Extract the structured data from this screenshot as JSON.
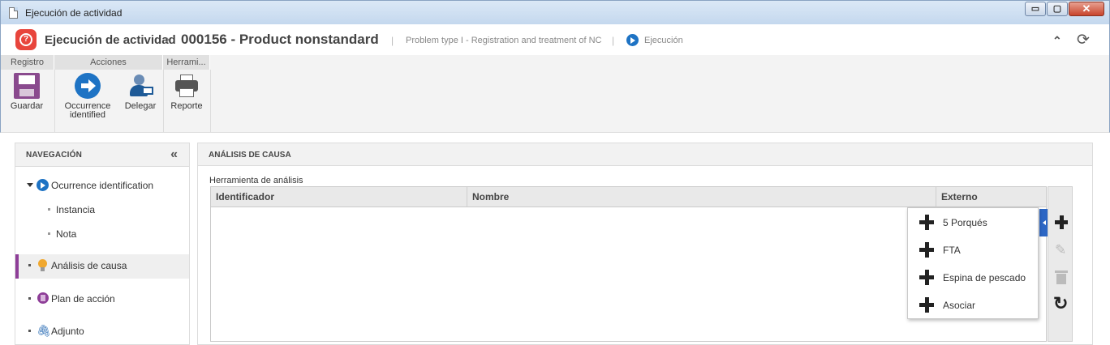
{
  "window": {
    "title": "Ejecución de actividad",
    "buttons": {
      "minimize": "▭",
      "maximize": "▢",
      "close": "✕"
    }
  },
  "header": {
    "logo_glyph": "?",
    "title": "Ejecución de actividad",
    "separator": "›",
    "record": "000156 - Product nonstandard",
    "divider": "|",
    "process": "Problem type I - Registration and treatment of NC",
    "status": "Ejecución",
    "collapse_glyph": "⌃",
    "refresh_glyph": "⟳"
  },
  "ribbon": {
    "groups": [
      {
        "label": "Registro"
      },
      {
        "label": "Acciones"
      },
      {
        "label": "Herrami..."
      }
    ],
    "buttons": {
      "save": "Guardar",
      "occurrence_line1": "Occurrence",
      "occurrence_line2": "identified",
      "delegate": "Delegar",
      "report": "Reporte"
    }
  },
  "navigation": {
    "title": "NAVEGACIÓN",
    "collapse_glyph": "«",
    "items": [
      {
        "label": "Ocurrence identification"
      },
      {
        "label": "Instancia"
      },
      {
        "label": "Nota"
      },
      {
        "label": "Análisis de causa"
      },
      {
        "label": "Plan de acción"
      },
      {
        "label": "Adjunto"
      }
    ],
    "clip_glyph": "🖇"
  },
  "main": {
    "title": "ANÁLISIS DE CAUSA",
    "field_label": "Herramienta de análisis",
    "columns": [
      "Identificador",
      "Nombre",
      "Externo"
    ],
    "tools": {
      "pencil_glyph": "✎",
      "refresh_glyph": "↻"
    }
  },
  "menu": {
    "items": [
      {
        "label": "5 Porqués"
      },
      {
        "label": "FTA"
      },
      {
        "label": "Espina de pescado"
      },
      {
        "label": "Asociar"
      }
    ]
  },
  "colors": {
    "accent_purple": "#8e3e98",
    "brand_red": "#e8453c",
    "primary_blue": "#1e73c4"
  }
}
